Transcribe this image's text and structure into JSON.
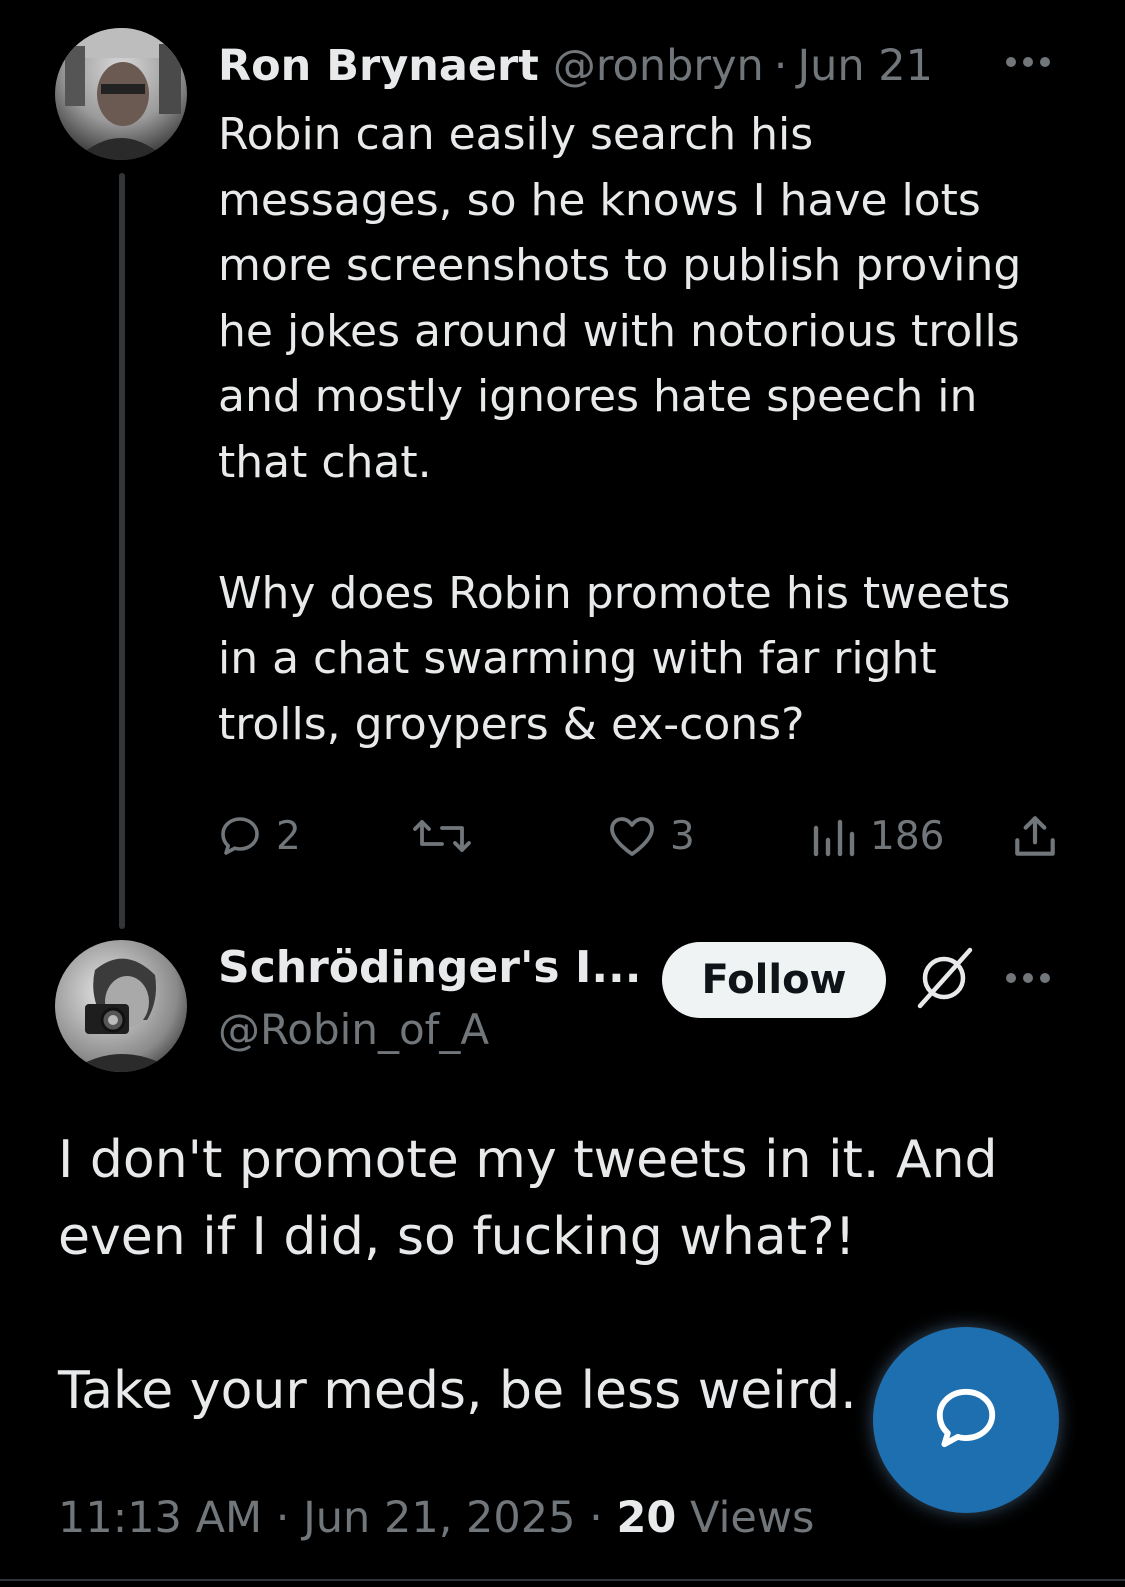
{
  "parent_tweet": {
    "author_name": "Ron Brynaert",
    "handle": "@ronbryn",
    "separator": "·",
    "date": "Jun 21",
    "text": "Robin can easily search his\nmessages, so he knows I have lots\nmore screenshots to publish proving\nhe jokes around with notorious trolls\nand mostly ignores hate speech in\nthat chat.\n\nWhy does Robin promote his tweets\nin a chat swarming with far right\ntrolls, groypers & ex-cons?",
    "actions": {
      "replies": "2",
      "reposts": "",
      "likes": "3",
      "views": "186"
    },
    "icons": [
      "reply-icon",
      "repost-icon",
      "like-icon",
      "views-icon",
      "share-icon",
      "more-icon"
    ]
  },
  "reply_tweet": {
    "author_name": "Schrödinger's I...",
    "handle": "@Robin_of_A",
    "follow_label": "Follow",
    "text": "I don't promote my tweets in it. And\neven if I did, so fucking what?!\n\nTake your meds, be less weird.",
    "time": "11:13 AM",
    "separator": "·",
    "date": "Jun 21, 2025",
    "views_count": "20",
    "views_label": "Views",
    "icons": [
      "no-sign-icon",
      "more-icon",
      "compose-reply-icon"
    ]
  },
  "colors": {
    "background": "#000000",
    "primary_text": "#e7e9ea",
    "secondary_text": "#71767b",
    "thread_line": "#333639",
    "follow_button_bg": "#eff3f4",
    "fab_bg": "#1d6fb0"
  }
}
